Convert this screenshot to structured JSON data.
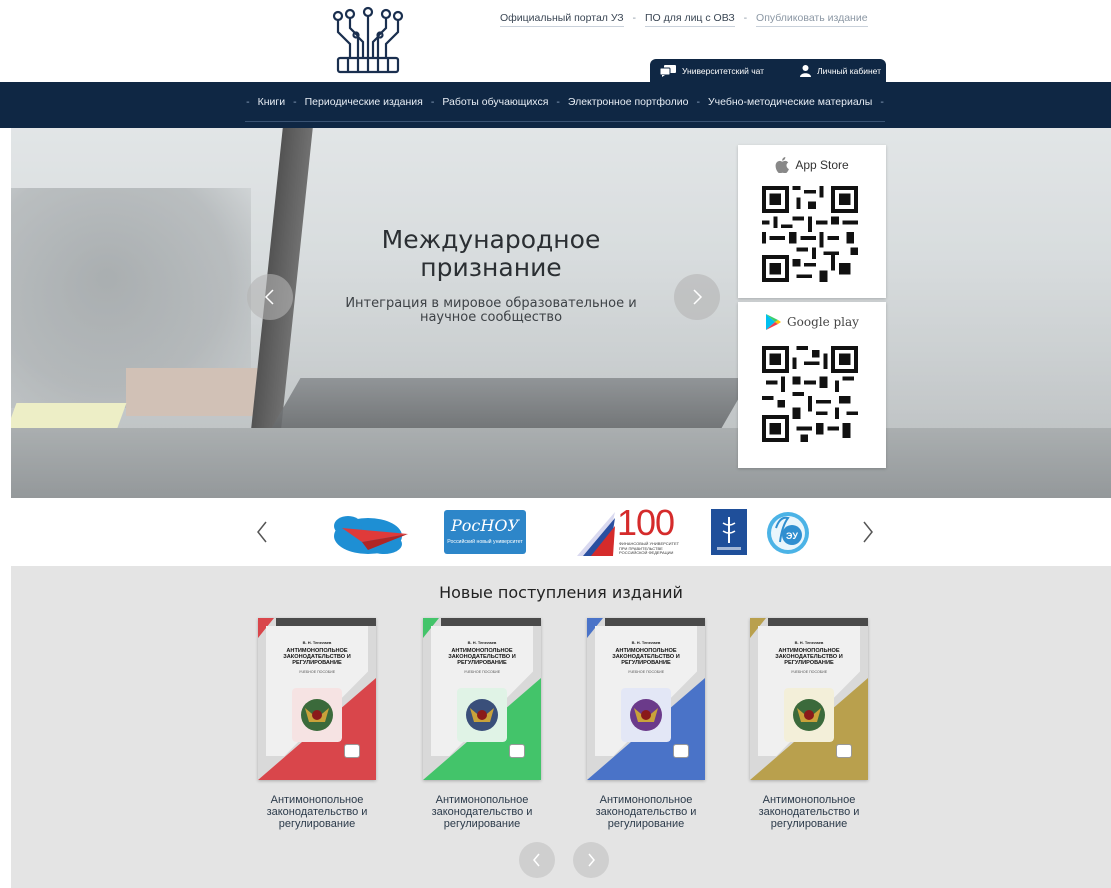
{
  "header": {
    "logo_icon": "circuit-logo-icon",
    "top_links": [
      {
        "label": "Официальный портал УЗ"
      },
      {
        "label": "ПО для лиц с ОВЗ"
      },
      {
        "label": "Опубликовать издание"
      }
    ],
    "separator": "-",
    "tabs": [
      {
        "label": "Университетский чат",
        "icon": "chat-icon"
      },
      {
        "label": "Личный кабинет",
        "icon": "user-icon"
      }
    ]
  },
  "nav": {
    "dash": "-",
    "items": [
      {
        "label": "Книги"
      },
      {
        "label": "Периодические издания"
      },
      {
        "label": "Работы обучающихся"
      },
      {
        "label": "Электронное портфолио"
      },
      {
        "label": "Учебно-методические материалы"
      }
    ]
  },
  "hero": {
    "title": "Международное признание",
    "subtitle": "Интеграция в мировое образовательное и научное сообщество",
    "stores": [
      {
        "label": "App Store",
        "icon": "apple-icon"
      },
      {
        "label": "Google play",
        "icon": "google-play-icon"
      }
    ]
  },
  "partners": {
    "logos": [
      {
        "name": "paper-plane-logo"
      },
      {
        "name": "rosnou-logo",
        "text": "РосНОУ",
        "sub": "Российский новый университет"
      },
      {
        "name": "finuniversity-100-logo",
        "text": "100",
        "sub": "ФИНАНСОВЫЙ УНИВЕРСИТЕТ ПРИ ПРАВИТЕЛЬСТВЕ РОССИЙСКОЙ ФЕДЕРАЦИИ"
      },
      {
        "name": "medical-book-logo"
      },
      {
        "name": "seu-logo",
        "text": "ЭУ"
      }
    ]
  },
  "arrivals": {
    "title": "Новые поступления изданий",
    "books": [
      {
        "title": "Антимонопольное законодательство и регулирование",
        "color": "#d9464b",
        "author": "В. Н. Тенелаев",
        "cover_title": "АНТИМОНОПОЛЬНОЕ ЗАКОНОДАТЕЛЬСТВО И РЕГУЛИРОВАНИЕ",
        "type": "УЧЕБНОЕ ПОСОБИЕ"
      },
      {
        "title": "Антимонопольное законодательство и регулирование",
        "color": "#43c46a",
        "author": "В. Н. Тенелаев",
        "cover_title": "АНТИМОНОПОЛЬНОЕ ЗАКОНОДАТЕЛЬСТВО И РЕГУЛИРОВАНИЕ",
        "type": "УЧЕБНОЕ ПОСОБИЕ"
      },
      {
        "title": "Антимонопольное законодательство и регулирование",
        "color": "#4a73c8",
        "author": "В. Н. Тенелаев",
        "cover_title": "АНТИМОНОПОЛЬНОЕ ЗАКОНОДАТЕЛЬСТВО И РЕГУЛИРОВАНИЕ",
        "type": "УЧЕБНОЕ ПОСОБИЕ"
      },
      {
        "title": "Антимонопольное законодательство и регулирование",
        "color": "#b9a04d",
        "author": "В. Н. Тенелаев",
        "cover_title": "АНТИМОНОПОЛЬНОЕ ЗАКОНОДАТЕЛЬСТВО И РЕГУЛИРОВАНИЕ",
        "type": "УЧЕБНОЕ ПОСОБИЕ"
      }
    ]
  },
  "colors": {
    "navy": "#0f2744",
    "arrivals_bg": "#e4e4e4"
  }
}
